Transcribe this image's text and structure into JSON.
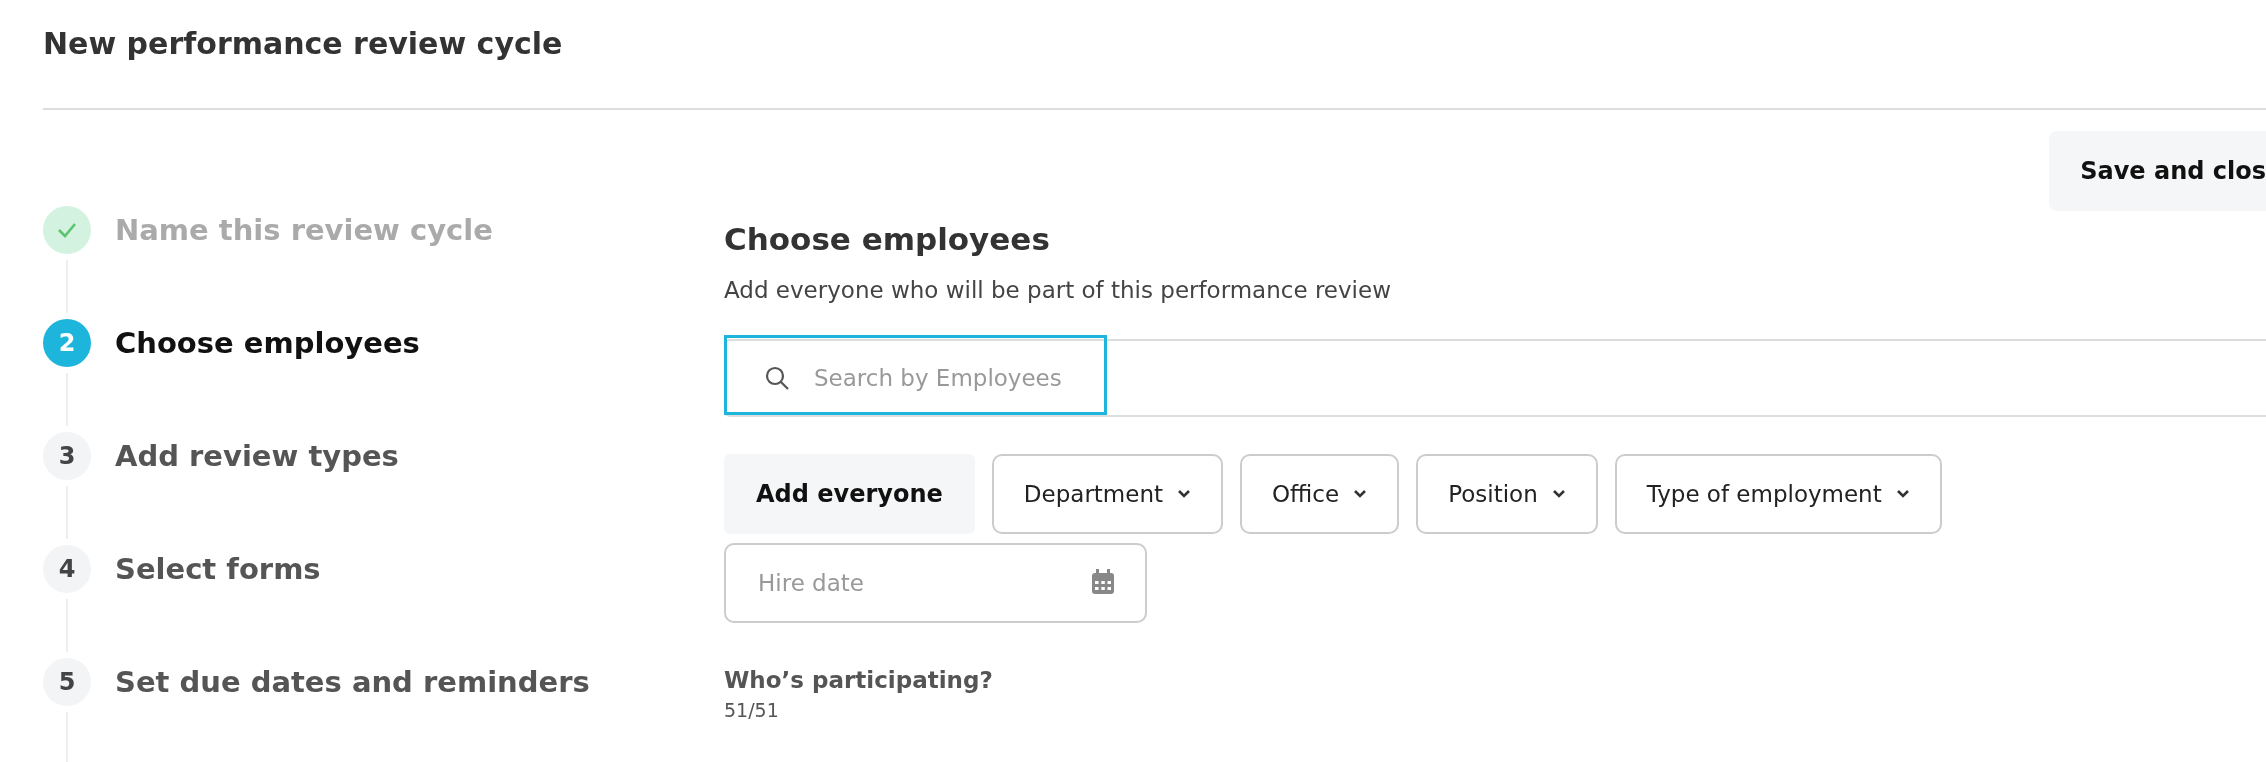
{
  "page_title": "New performance review cycle",
  "save_button": "Save and clos",
  "steps": [
    {
      "label": "Name this review cycle",
      "completed": true,
      "selected": false
    },
    {
      "number": "2",
      "label": "Choose employees",
      "completed": false,
      "selected": true
    },
    {
      "number": "3",
      "label": "Add review types",
      "completed": false,
      "selected": false
    },
    {
      "number": "4",
      "label": "Select forms",
      "completed": false,
      "selected": false
    },
    {
      "number": "5",
      "label": "Set due dates and reminders",
      "completed": false,
      "selected": false
    }
  ],
  "section": {
    "title": "Choose employees",
    "subtitle": "Add everyone who will be part of this performance review"
  },
  "search": {
    "placeholder": "Search by Employees",
    "focused": true
  },
  "add_everyone": "Add everyone",
  "filters": [
    {
      "label": "Department",
      "kind": "dropdown"
    },
    {
      "label": "Office",
      "kind": "dropdown"
    },
    {
      "label": "Position",
      "kind": "dropdown"
    },
    {
      "label": "Type of employment",
      "kind": "dropdown"
    },
    {
      "placeholder": "Hire date",
      "kind": "date"
    }
  ],
  "participants": {
    "heading": "Who’s participating?",
    "count": "51/51"
  }
}
